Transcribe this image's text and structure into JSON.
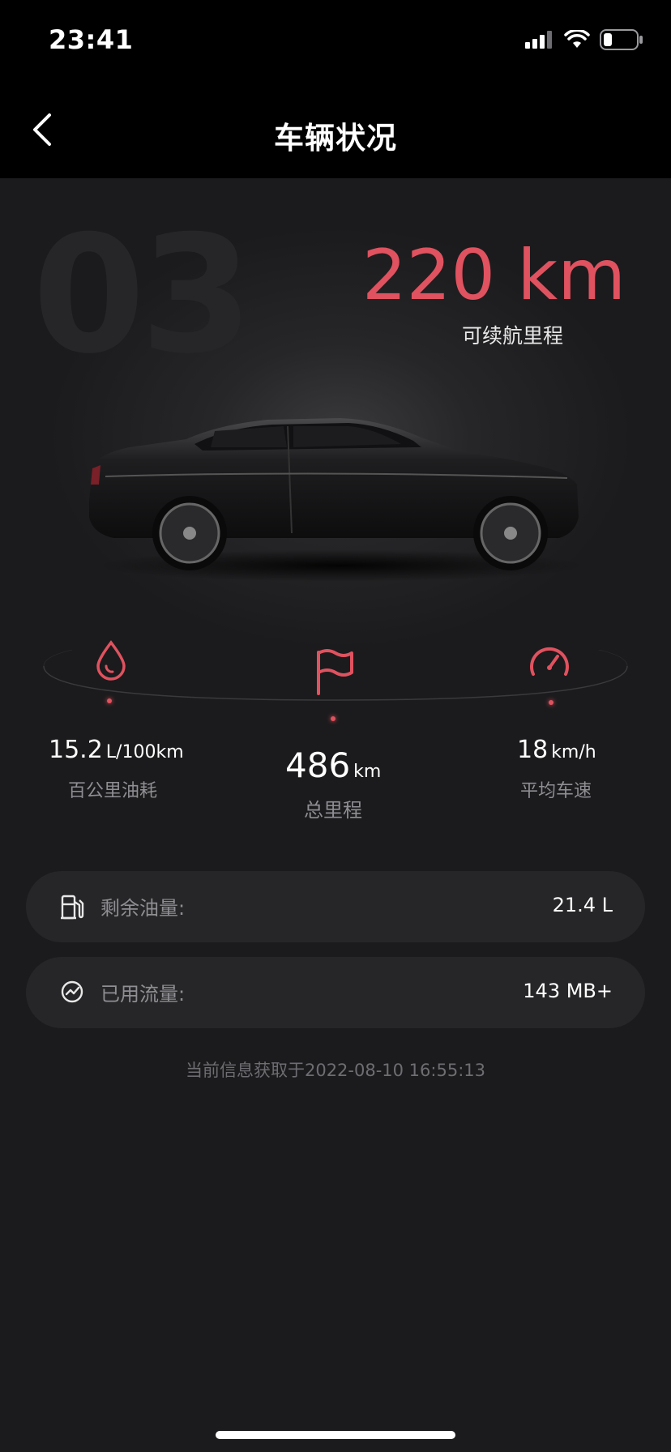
{
  "status_bar": {
    "time": "23:41"
  },
  "nav": {
    "title": "车辆状况"
  },
  "hero": {
    "model_watermark": "03",
    "range_value": "220 km",
    "range_label": "可续航里程"
  },
  "stats": {
    "fuel_consumption": {
      "value": "15.2",
      "unit": "L/100km",
      "label": "百公里油耗",
      "icon": "droplet-icon"
    },
    "total_mileage": {
      "value": "486",
      "unit": "km",
      "label": "总里程",
      "icon": "flag-icon"
    },
    "average_speed": {
      "value": "18",
      "unit": "km/h",
      "label": "平均车速",
      "icon": "speedometer-icon"
    }
  },
  "cards": {
    "fuel_remaining": {
      "label": "剩余油量:",
      "value": "21.4 L",
      "icon": "fuel-pump-icon"
    },
    "data_used": {
      "label": "已用流量:",
      "value": "143 MB+",
      "icon": "traffic-chart-icon"
    }
  },
  "timestamp": "当前信息获取于2022-08-10 16:55:13",
  "colors": {
    "accent": "#e0525f",
    "background": "#1b1b1d",
    "card": "#262628"
  }
}
